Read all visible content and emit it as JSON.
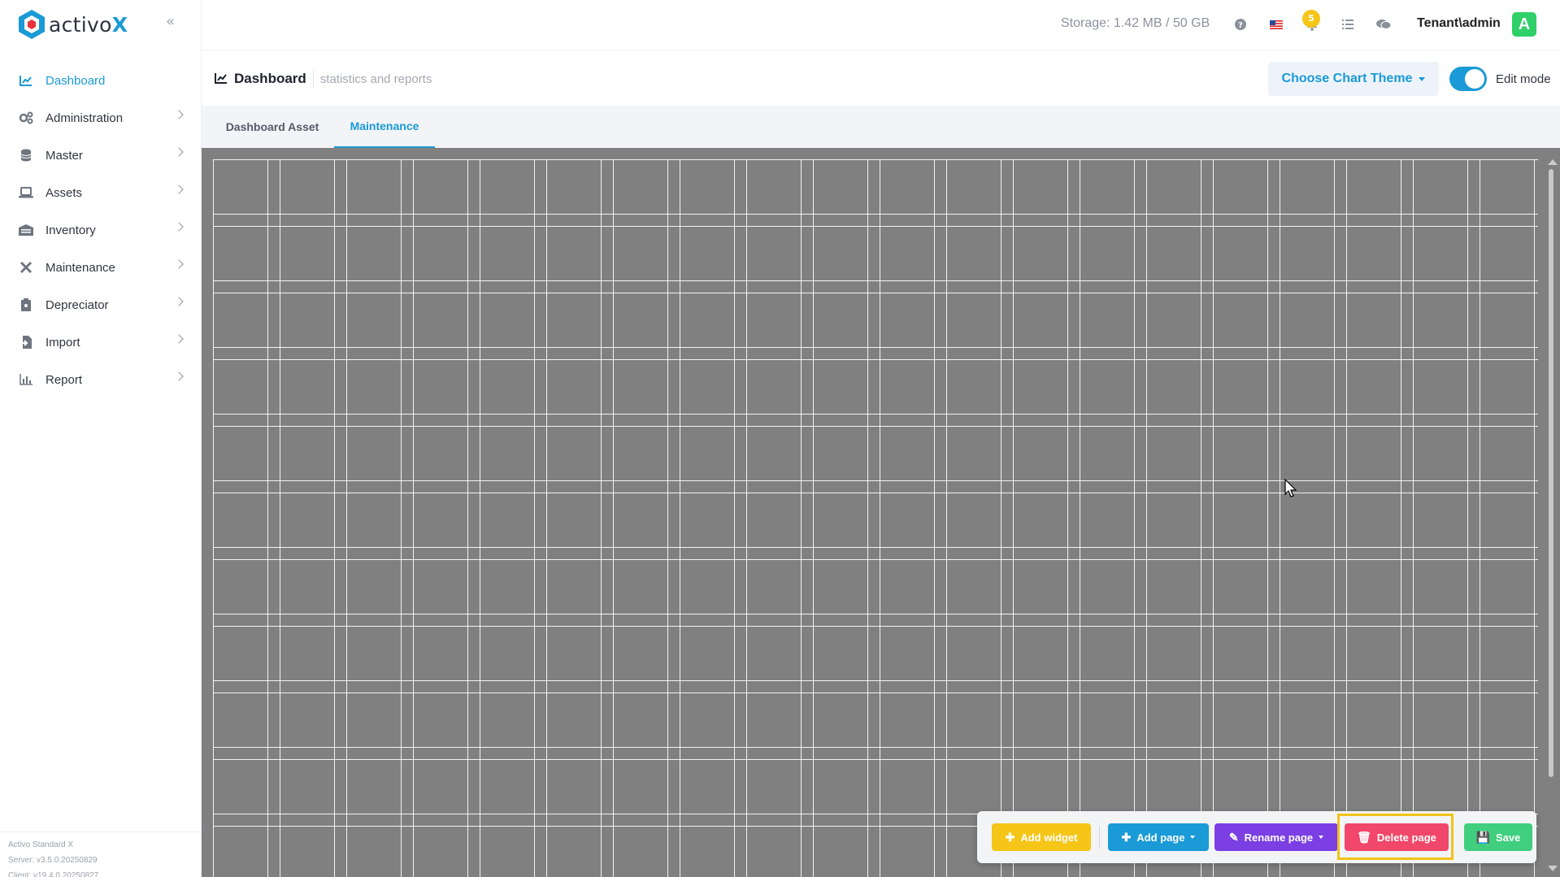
{
  "brand": {
    "name_prefix": "activo",
    "name_suffix": "X"
  },
  "sidebar": {
    "items": [
      {
        "label": "Dashboard",
        "icon": "chart-line-icon",
        "active": true
      },
      {
        "label": "Administration",
        "icon": "cogs-icon"
      },
      {
        "label": "Master",
        "icon": "database-icon"
      },
      {
        "label": "Assets",
        "icon": "laptop-icon"
      },
      {
        "label": "Inventory",
        "icon": "warehouse-icon"
      },
      {
        "label": "Maintenance",
        "icon": "tools-icon"
      },
      {
        "label": "Depreciator",
        "icon": "clipboard-icon"
      },
      {
        "label": "Import",
        "icon": "file-import-icon"
      },
      {
        "label": "Report",
        "icon": "bar-chart-icon"
      }
    ],
    "footer": {
      "product": "Activo Standard X",
      "server": "Server: v3.5.0.20250829",
      "client": "Client: v19.4.0.20250827"
    }
  },
  "topbar": {
    "storage": "Storage: 1.42 MB / 50 GB",
    "notification_count": "5",
    "user": "Tenant\\admin",
    "avatar_letter": "A"
  },
  "header": {
    "title": "Dashboard",
    "subtitle": "statistics and reports",
    "theme_button": "Choose Chart Theme",
    "edit_mode_label": "Edit mode",
    "edit_mode_on": true
  },
  "tabs": [
    {
      "label": "Dashboard Asset",
      "active": false
    },
    {
      "label": "Maintenance",
      "active": true
    }
  ],
  "actions": {
    "add_widget": "Add widget",
    "add_page": "Add page",
    "rename_page": "Rename page",
    "delete_page": "Delete page",
    "save": "Save"
  },
  "colors": {
    "accent": "#1a9ad6",
    "add_widget": "#f5c518",
    "add_page": "#1a9ad6",
    "rename_page": "#7b3fe4",
    "delete_page": "#f0476a",
    "save": "#3fcf7e",
    "highlight": "#f2c21a",
    "grid_bg": "#808080"
  }
}
